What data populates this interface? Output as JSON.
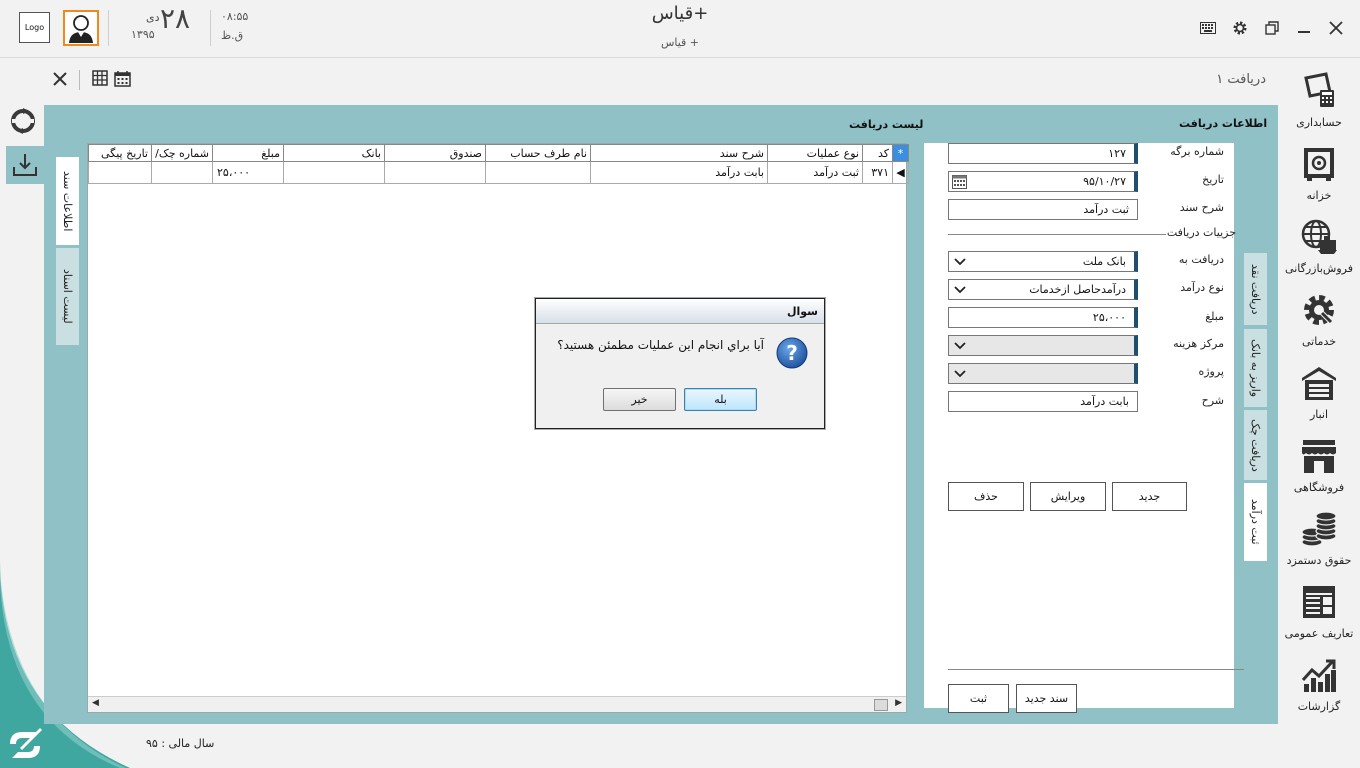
{
  "header": {
    "logo_text": "Logo",
    "day_number": "۲۸",
    "month": "دی",
    "year": "۱۳۹۵",
    "time": "۰۸:۵۵",
    "ampm": "ق.ظ",
    "app_title": "قیاس+",
    "app_subtitle": "قیاس +"
  },
  "toolbar": {
    "doc_tab_title": "دریافت ۱"
  },
  "right_nav": {
    "items": [
      {
        "label": "حسابداری",
        "icon": "accounting-icon"
      },
      {
        "label": "خزانه",
        "icon": "safe-icon"
      },
      {
        "label": "فروش‌بازرگانی",
        "icon": "globe-trade-icon"
      },
      {
        "label": "خدماتی",
        "icon": "gear-service-icon"
      },
      {
        "label": "انبار",
        "icon": "warehouse-icon"
      },
      {
        "label": "فروشگاهی",
        "icon": "store-icon"
      },
      {
        "label": "حقوق دستمزد",
        "icon": "coins-icon"
      },
      {
        "label": "تعاریف عمومی",
        "icon": "layout-icon"
      },
      {
        "label": "گزارشات",
        "icon": "chart-icon"
      }
    ]
  },
  "left_tabs": {
    "doc_info": "اطلاعات سند",
    "doc_list": "لیست اسناد"
  },
  "right_tabs": {
    "cash": "دریافت نقد",
    "bank_transfer": "واریز به بانک",
    "check": "دریافت چک",
    "income": "ثبت درآمد"
  },
  "grid": {
    "title": "لیست دریافت",
    "columns": [
      "کد",
      "نوع عملیات",
      "شرح سند",
      "نام طرف حساب",
      "صندوق",
      "بانک",
      "مبلغ",
      "شماره چک/",
      "تاریخ پیگی"
    ],
    "rows": [
      [
        "۳۷۱",
        "ثبت درآمد",
        "بابت درآمد",
        "",
        "",
        "",
        "۲۵،۰۰۰",
        "",
        ""
      ]
    ]
  },
  "form": {
    "title": "اطلاعات دریافت",
    "sheet_no_label": "شماره برگه",
    "sheet_no": "۱۲۷",
    "date_label": "تاریخ",
    "date": "۹۵/۱۰/۲۷",
    "desc_label": "شرح سند",
    "desc": "ثبت درآمد",
    "details_label": "جزییات دریافت",
    "receive_to_label": "دریافت به",
    "receive_to": "بانک ملت",
    "income_type_label": "نوع درآمد",
    "income_type": "درآمدحاصل ازخدمات",
    "amount_label": "مبلغ",
    "amount": "۲۵،۰۰۰",
    "cost_center_label": "مرکز هزینه",
    "cost_center": "",
    "project_label": "پروژه",
    "project": "",
    "note_label": "شرح",
    "note": "بابت درآمد",
    "btn_new": "جدید",
    "btn_edit": "ویرایش",
    "btn_delete": "حذف",
    "btn_new_doc": "سند جدید",
    "btn_save": "ثبت"
  },
  "dialog": {
    "title": "سوال",
    "message": "آیا براي انجام این عملیات مطمئن هستید؟",
    "yes": "بله",
    "no": "خیر"
  },
  "footer": {
    "fiscal_year": "سال مالی : ۹۵"
  },
  "colors": {
    "panel": "#8fc1c6",
    "accent_orange": "#f08a1c",
    "grid_star": "#3d8ee0",
    "dark_accent": "#1f4f6f"
  }
}
